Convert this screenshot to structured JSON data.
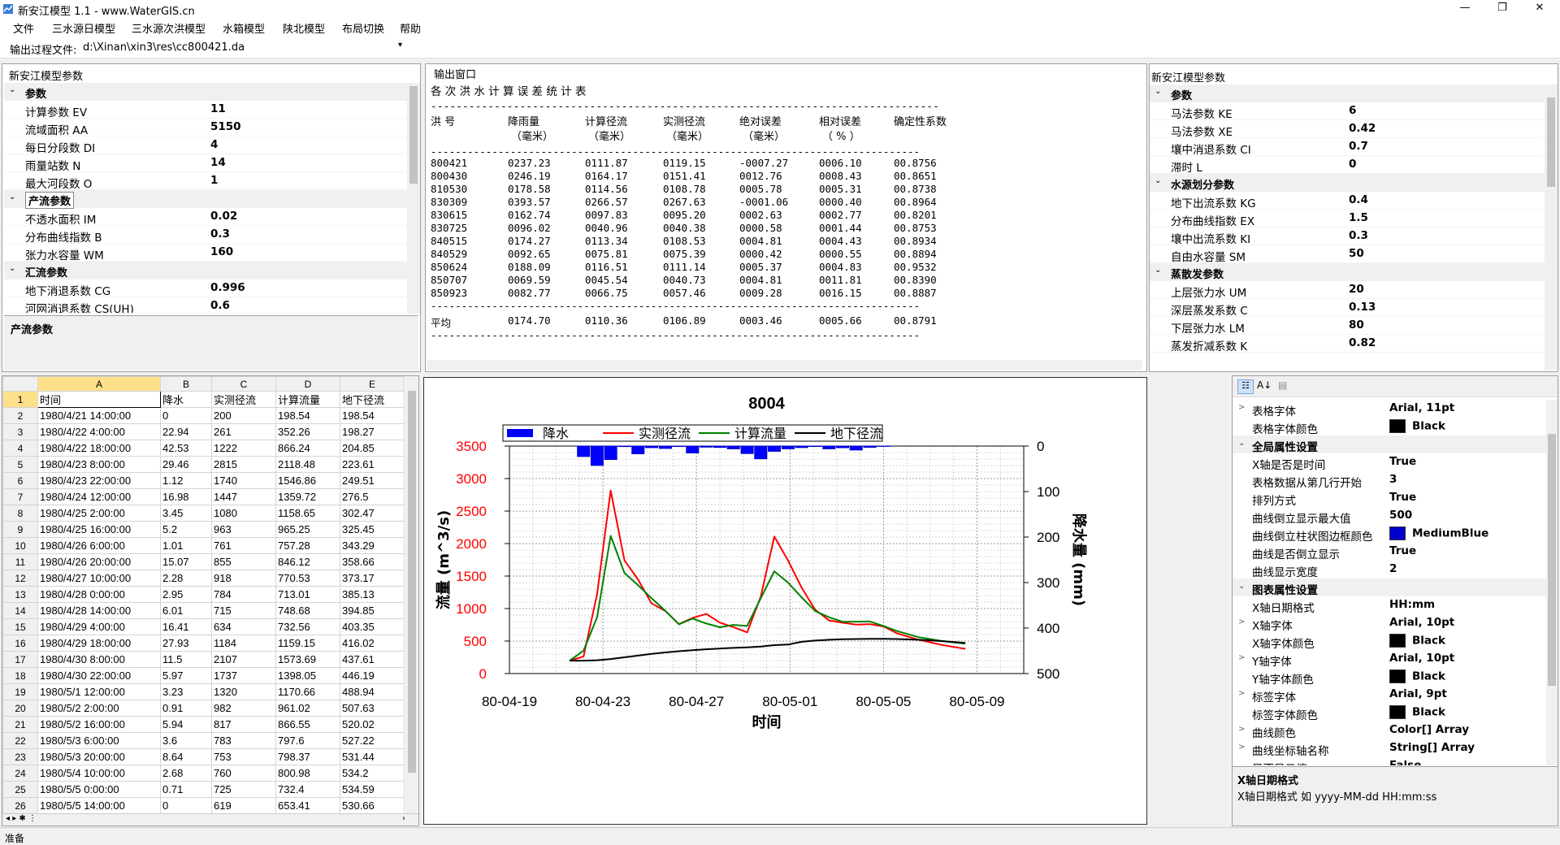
{
  "window": {
    "title": "新安江模型 1.1 - www.WaterGIS.cn",
    "min": "—",
    "max": "❐",
    "close": "✕"
  },
  "menu": [
    "文件",
    "三水源日模型",
    "三水源次洪模型",
    "水箱模型",
    "陕北模型",
    "布局切换",
    "帮助"
  ],
  "pathbar": {
    "label": "输出过程文件:",
    "value": "d:\\Xinan\\xin3\\res\\cc800421.da"
  },
  "left_params": {
    "title": "新安江模型参数",
    "groups": [
      {
        "name": "参数",
        "rows": [
          [
            "计算参数 EV",
            "11"
          ],
          [
            "流域面积 AA",
            "5150"
          ],
          [
            "每日分段数 DI",
            "4"
          ],
          [
            "雨量站数 N",
            "14"
          ],
          [
            "最大河段数 O",
            "1"
          ]
        ]
      },
      {
        "name": "产流参数",
        "rows": [
          [
            "不透水面积 IM",
            "0.02"
          ],
          [
            "分布曲线指数 B",
            "0.3"
          ],
          [
            "张力水容量 WM",
            "160"
          ]
        ]
      },
      {
        "name": "汇流参数",
        "rows": [
          [
            "地下消退系数 CG",
            "0.996"
          ],
          [
            "河网消退系数 CS(UH)",
            "0.6"
          ]
        ]
      }
    ],
    "desc_title": "产流参数"
  },
  "output": {
    "title": "输出窗口",
    "heading": "各 次 洪 水 计 算 误 差 统 计 表",
    "sep": "--------------------------------------------------------------------------------",
    "headers1": [
      "洪 号",
      "降雨量",
      "计算径流",
      "实测径流",
      "绝对误差",
      "相对误差",
      "确定性系数"
    ],
    "headers2": [
      "",
      "（毫米）",
      "（毫米）",
      "（毫米）",
      "（毫米）",
      "（ % ）",
      ""
    ],
    "rows": [
      [
        "800421",
        "0237.23",
        "0111.87",
        "0119.15",
        "-0007.27",
        "0006.10",
        "00.8756"
      ],
      [
        "800430",
        "0246.19",
        "0164.17",
        "0151.41",
        "0012.76",
        "0008.43",
        "00.8651"
      ],
      [
        "810530",
        "0178.58",
        "0114.56",
        "0108.78",
        "0005.78",
        "0005.31",
        "00.8738"
      ],
      [
        "830309",
        "0393.57",
        "0266.57",
        "0267.63",
        "-0001.06",
        "0000.40",
        "00.8964"
      ],
      [
        "830615",
        "0162.74",
        "0097.83",
        "0095.20",
        "0002.63",
        "0002.77",
        "00.8201"
      ],
      [
        "830725",
        "0096.02",
        "0040.96",
        "0040.38",
        "0000.58",
        "0001.44",
        "00.8753"
      ],
      [
        "840515",
        "0174.27",
        "0113.34",
        "0108.53",
        "0004.81",
        "0004.43",
        "00.8934"
      ],
      [
        "840529",
        "0092.65",
        "0075.81",
        "0075.39",
        "0000.42",
        "0000.55",
        "00.8894"
      ],
      [
        "850624",
        "0188.09",
        "0116.51",
        "0111.14",
        "0005.37",
        "0004.83",
        "00.9532"
      ],
      [
        "850707",
        "0069.59",
        "0045.54",
        "0040.73",
        "0004.81",
        "0011.81",
        "00.8390"
      ],
      [
        "850923",
        "0082.77",
        "0066.75",
        "0057.46",
        "0009.28",
        "0016.15",
        "00.8887"
      ]
    ],
    "avg": [
      "平均",
      "0174.70",
      "0110.36",
      "0106.89",
      "0003.46",
      "0005.66",
      "00.8791"
    ]
  },
  "right_params": {
    "title": "新安江模型参数",
    "groups": [
      {
        "name": "参数",
        "rows": [
          [
            "马法参数 KE",
            "6"
          ],
          [
            "马法参数 XE",
            "0.42"
          ],
          [
            "壤中消退系数 CI",
            "0.7"
          ],
          [
            "滞时 L",
            "0"
          ]
        ]
      },
      {
        "name": "水源划分参数",
        "rows": [
          [
            "地下出流系数 KG",
            "0.4"
          ],
          [
            "分布曲线指数 EX",
            "1.5"
          ],
          [
            "壤中出流系数 KI",
            "0.3"
          ],
          [
            "自由水容量 SM",
            "50"
          ]
        ]
      },
      {
        "name": "蒸散发参数",
        "rows": [
          [
            "上层张力水 UM",
            "20"
          ],
          [
            "深层蒸发系数 C",
            "0.13"
          ],
          [
            "下层张力水 LM",
            "80"
          ],
          [
            "蒸发折减系数 K",
            "0.82"
          ]
        ]
      }
    ]
  },
  "sheet": {
    "cols": [
      "A",
      "B",
      "C",
      "D",
      "E"
    ],
    "header": [
      "时间",
      "降水",
      "实测径流",
      "计算流量",
      "地下径流"
    ],
    "rows": [
      [
        "1980/4/21 14:00:00",
        "0",
        "200",
        "198.54",
        "198.54"
      ],
      [
        "1980/4/22 4:00:00",
        "22.94",
        "261",
        "352.26",
        "198.27"
      ],
      [
        "1980/4/22 18:00:00",
        "42.53",
        "1222",
        "866.24",
        "204.85"
      ],
      [
        "1980/4/23 8:00:00",
        "29.46",
        "2815",
        "2118.48",
        "223.61"
      ],
      [
        "1980/4/23 22:00:00",
        "1.12",
        "1740",
        "1546.86",
        "249.51"
      ],
      [
        "1980/4/24 12:00:00",
        "16.98",
        "1447",
        "1359.72",
        "276.5"
      ],
      [
        "1980/4/25 2:00:00",
        "3.45",
        "1080",
        "1158.65",
        "302.47"
      ],
      [
        "1980/4/25 16:00:00",
        "5.2",
        "963",
        "965.25",
        "325.45"
      ],
      [
        "1980/4/26 6:00:00",
        "1.01",
        "761",
        "757.28",
        "343.29"
      ],
      [
        "1980/4/26 20:00:00",
        "15.07",
        "855",
        "846.12",
        "358.66"
      ],
      [
        "1980/4/27 10:00:00",
        "2.28",
        "918",
        "770.53",
        "373.17"
      ],
      [
        "1980/4/28 0:00:00",
        "2.95",
        "784",
        "713.01",
        "385.13"
      ],
      [
        "1980/4/28 14:00:00",
        "6.01",
        "715",
        "748.68",
        "394.85"
      ],
      [
        "1980/4/29 4:00:00",
        "16.41",
        "634",
        "732.56",
        "403.35"
      ],
      [
        "1980/4/29 18:00:00",
        "27.93",
        "1184",
        "1159.15",
        "416.02"
      ],
      [
        "1980/4/30 8:00:00",
        "11.5",
        "2107",
        "1573.69",
        "437.61"
      ],
      [
        "1980/4/30 22:00:00",
        "5.97",
        "1737",
        "1398.05",
        "446.19"
      ],
      [
        "1980/5/1 12:00:00",
        "3.23",
        "1320",
        "1170.66",
        "488.94"
      ],
      [
        "1980/5/2 2:00:00",
        "0.91",
        "982",
        "961.02",
        "507.63"
      ],
      [
        "1980/5/2 16:00:00",
        "5.94",
        "817",
        "866.55",
        "520.02"
      ],
      [
        "1980/5/3 6:00:00",
        "3.6",
        "783",
        "797.6",
        "527.22"
      ],
      [
        "1980/5/3 20:00:00",
        "8.64",
        "753",
        "798.37",
        "531.44"
      ],
      [
        "1980/5/4 10:00:00",
        "2.68",
        "760",
        "800.98",
        "534.2"
      ],
      [
        "1980/5/5 0:00:00",
        "0.71",
        "725",
        "732.4",
        "534.59"
      ],
      [
        "1980/5/5 14:00:00",
        "0",
        "619",
        "653.41",
        "530.66"
      ]
    ]
  },
  "chart_data": {
    "type": "line",
    "title": "8004",
    "xlabel": "时间",
    "ylabel": "流量 (m^3/s)",
    "y2label": "降水量 (mm)",
    "ylim": [
      0,
      3500
    ],
    "y2lim": [
      0,
      500
    ],
    "y2_inverted": true,
    "x_ticks": [
      "80-04-19",
      "80-04-23",
      "80-04-27",
      "80-05-01",
      "80-05-05",
      "80-05-09"
    ],
    "y_ticks": [
      "3500",
      "3000",
      "2500",
      "2000",
      "1500",
      "1000",
      "500",
      "0"
    ],
    "y2_ticks": [
      "0",
      "100",
      "200",
      "300",
      "400",
      "500"
    ],
    "legend": [
      "降水",
      "实测径流",
      "计算流量",
      "地下径流"
    ],
    "colors": {
      "rain": "#0000ff",
      "observed": "#ff0000",
      "computed": "#008000",
      "base": "#000000"
    },
    "x_days": [
      2.58,
      3.17,
      3.75,
      4.33,
      4.92,
      5.5,
      6.08,
      6.67,
      7.25,
      7.83,
      8.42,
      9.0,
      9.58,
      10.17,
      10.75,
      11.33,
      11.92,
      12.5,
      13.08,
      13.67,
      14.25,
      14.83,
      15.42,
      16.0,
      16.58,
      17.5,
      18.5,
      19.5
    ],
    "rain": [
      0,
      22.94,
      42.53,
      29.46,
      1.12,
      16.98,
      3.45,
      5.2,
      1.01,
      15.07,
      2.28,
      2.95,
      6.01,
      16.41,
      27.93,
      11.5,
      5.97,
      3.23,
      0.91,
      5.94,
      3.6,
      8.64,
      2.68,
      0.71,
      0,
      0,
      0,
      0
    ],
    "observed": [
      200,
      261,
      1222,
      2815,
      1740,
      1447,
      1080,
      963,
      761,
      855,
      918,
      784,
      715,
      634,
      1184,
      2107,
      1737,
      1320,
      982,
      817,
      783,
      753,
      760,
      725,
      619,
      520,
      440,
      380
    ],
    "computed": [
      198.54,
      352.26,
      866.24,
      2118.48,
      1546.86,
      1359.72,
      1158.65,
      965.25,
      757.28,
      846.12,
      770.53,
      713.01,
      748.68,
      732.56,
      1159.15,
      1573.69,
      1398.05,
      1170.66,
      961.02,
      866.55,
      797.6,
      798.37,
      800.98,
      732.4,
      653.41,
      560,
      500,
      460
    ],
    "base": [
      198.54,
      198.27,
      204.85,
      223.61,
      249.51,
      276.5,
      302.47,
      325.45,
      343.29,
      358.66,
      373.17,
      385.13,
      394.85,
      403.35,
      416.02,
      437.61,
      446.19,
      488.94,
      507.63,
      520.02,
      527.22,
      531.44,
      534.2,
      534.59,
      530.66,
      520,
      500,
      470
    ]
  },
  "propgrid": {
    "rows": [
      {
        "t": "row",
        "ex": ">",
        "k": "表格字体",
        "v": "Arial, 11pt"
      },
      {
        "t": "row",
        "ex": "",
        "k": "表格字体颜色",
        "v": "Black",
        "sw": "#000000"
      },
      {
        "t": "grp",
        "k": "全局属性设置"
      },
      {
        "t": "row",
        "ex": "",
        "k": "X轴是否是时间",
        "v": "True"
      },
      {
        "t": "row",
        "ex": "",
        "k": "表格数据从第几行开始",
        "v": "3"
      },
      {
        "t": "row",
        "ex": "",
        "k": "排列方式",
        "v": "True"
      },
      {
        "t": "row",
        "ex": "",
        "k": "曲线倒立显示最大值",
        "v": "500"
      },
      {
        "t": "row",
        "ex": "",
        "k": "曲线倒立柱状图边框颜色",
        "v": "MediumBlue",
        "sw": "#0000cd"
      },
      {
        "t": "row",
        "ex": "",
        "k": "曲线是否倒立显示",
        "v": "True"
      },
      {
        "t": "row",
        "ex": "",
        "k": "曲线显示宽度",
        "v": "2"
      },
      {
        "t": "grp",
        "k": "图表属性设置"
      },
      {
        "t": "row",
        "ex": "",
        "k": "X轴日期格式",
        "v": "HH:mm"
      },
      {
        "t": "row",
        "ex": ">",
        "k": "X轴字体",
        "v": "Arial, 10pt"
      },
      {
        "t": "row",
        "ex": "",
        "k": "X轴字体颜色",
        "v": "Black",
        "sw": "#000000"
      },
      {
        "t": "row",
        "ex": ">",
        "k": "Y轴字体",
        "v": "Arial, 10pt"
      },
      {
        "t": "row",
        "ex": "",
        "k": "Y轴字体颜色",
        "v": "Black",
        "sw": "#000000"
      },
      {
        "t": "row",
        "ex": ">",
        "k": "标签字体",
        "v": "Arial, 9pt"
      },
      {
        "t": "row",
        "ex": "",
        "k": "标签字体颜色",
        "v": "Black",
        "sw": "#000000"
      },
      {
        "t": "row",
        "ex": ">",
        "k": "曲线颜色",
        "v": "Color[] Array"
      },
      {
        "t": "row",
        "ex": ">",
        "k": "曲线坐标轴名称",
        "v": "String[] Array"
      },
      {
        "t": "row",
        "ex": "",
        "k": "是否显示缩...",
        "v": "False"
      }
    ],
    "desc_title": "X轴日期格式",
    "desc_text": "X轴日期格式 如 yyyy-MM-dd HH:mm:ss"
  },
  "status": "准备"
}
